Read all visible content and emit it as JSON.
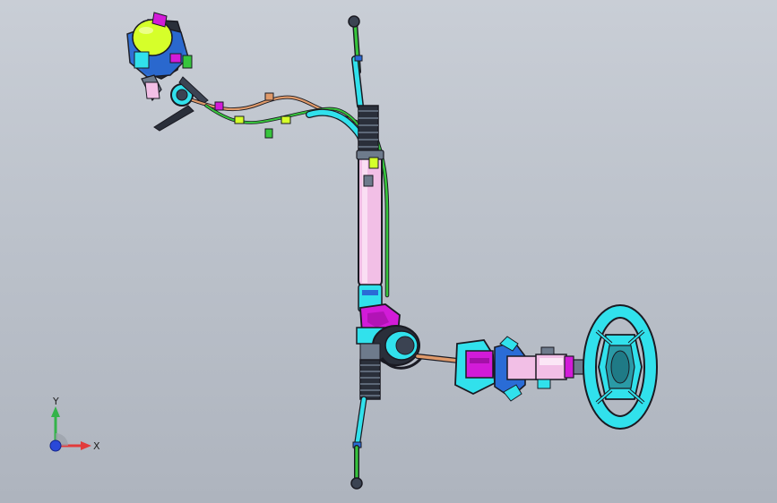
{
  "app": {
    "view_type": "3D CAD model viewport",
    "background_top": "#c9ced6",
    "background_bottom": "#aeb4be"
  },
  "model": {
    "colors": {
      "outline": "#1a1a22",
      "rack_housing": "#f2bfe6",
      "cyan_parts": "#31e1ec",
      "magenta_parts": "#d21bd8",
      "green_lines": "#37c53c",
      "yellow_green": "#d6ff2a",
      "orange_hose": "#e09a6a",
      "blue_parts": "#2a6cd6",
      "steel_parts": "#6e7b8c"
    },
    "icons": [
      "steering-wheel-icon",
      "steering-column-icon",
      "steering-rack-icon",
      "tie-rod-icon",
      "power-steering-pump-icon",
      "fluid-reservoir-icon",
      "hose-icon"
    ]
  },
  "triad": {
    "x_label": "X",
    "y_label": "Y",
    "colors": {
      "x": "#e23b3b",
      "y": "#34b34a",
      "origin": "#2a48d8"
    }
  }
}
